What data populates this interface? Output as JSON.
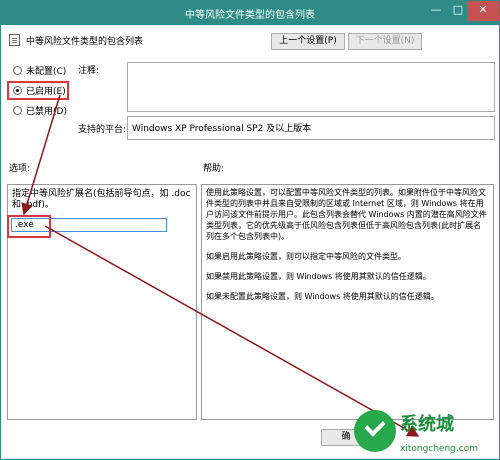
{
  "window": {
    "title": "中等风险文件类型的包含列表",
    "minimize_glyph": "—",
    "maximize_glyph": "□",
    "close_glyph": "✕"
  },
  "header": {
    "policy_name": "中等风险文件类型的包含列表",
    "prev_button": "上一个设置(P)",
    "next_button": "下一个设置(N)"
  },
  "state": {
    "options": [
      {
        "label": "未配置(C)",
        "selected": false
      },
      {
        "label": "已启用(E)",
        "selected": true
      },
      {
        "label": "已禁用(D)",
        "selected": false
      }
    ]
  },
  "comment": {
    "label": "注释:",
    "value": ""
  },
  "platform": {
    "label": "支持的平台:",
    "value": "Windows XP Professional SP2 及以上版本"
  },
  "options_section": {
    "label": "选项:",
    "description": "指定中等风险扩展名(包括前导句点，如 .doc 和 .pdf)。",
    "input_value": ".exe"
  },
  "help_section": {
    "label": "帮助:",
    "paragraphs": [
      "使用此策略设置，可以配置中等风险文件类型的列表。如果附件位于中等风险文件类型的列表中并且来自受限制的区域或 Internet 区域，则 Windows 将在用户访问该文件前提示用户。此包含列表会替代 Windows 内置的潜在高风险文件类型列表，它的优先级高于低风险包含列表但低于高风险包含列表(此时扩展名列在多个包含列表中)。",
      "如果启用此策略设置，则可以指定中等风险的文件类型。",
      "如果禁用此策略设置，则 Windows 将使用其默认的信任逻辑。",
      "如果未配置此策略设置，则 Windows 将使用其默认的信任逻辑。"
    ]
  },
  "footer": {
    "ok_label": "确"
  },
  "watermark": {
    "brand": "系统城",
    "url": "xitongcheng.com"
  },
  "colors": {
    "titlebar": "#2e8b86",
    "highlight": "#d9363e",
    "arrow": "#8b1a1a",
    "watermark": "#1e8f3e"
  }
}
